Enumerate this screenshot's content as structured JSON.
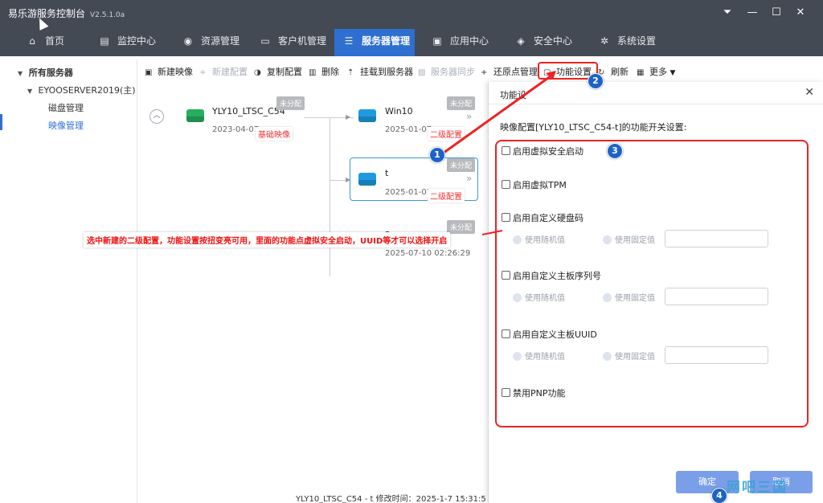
{
  "app": {
    "title": "易乐游服务控制台",
    "version": "V2.5.1.0a"
  },
  "window_controls": {
    "menu_icon": "menu-down-icon",
    "minimize": "—",
    "maximize": "☐",
    "close": "✕"
  },
  "nav": [
    {
      "label": "首页",
      "icon": "home-icon"
    },
    {
      "label": "监控中心",
      "icon": "monitor-chart-icon"
    },
    {
      "label": "资源管理",
      "icon": "gamepad-icon"
    },
    {
      "label": "客户机管理",
      "icon": "desktop-icon"
    },
    {
      "label": "服务器管理",
      "icon": "server-icon",
      "active": true
    },
    {
      "label": "应用中心",
      "icon": "briefcase-icon"
    },
    {
      "label": "安全中心",
      "icon": "shield-icon"
    },
    {
      "label": "系统设置",
      "icon": "gear-icon"
    }
  ],
  "sidebar": {
    "root": "所有服务器",
    "server": "EYOOSERVER2019(主)",
    "items": [
      {
        "label": "磁盘管理"
      },
      {
        "label": "映像管理",
        "selected": true
      }
    ]
  },
  "toolbar": [
    {
      "label": "新建映像",
      "icon": "new-image-icon",
      "enabled": true
    },
    {
      "label": "新建配置",
      "icon": "plus-icon",
      "enabled": false
    },
    {
      "label": "复制配置",
      "icon": "copy-icon",
      "enabled": true
    },
    {
      "label": "删除",
      "icon": "trash-icon",
      "enabled": true
    },
    {
      "label": "挂载到服务器",
      "icon": "mount-icon",
      "enabled": true
    },
    {
      "label": "服务器同步",
      "icon": "sync-icon",
      "enabled": false
    },
    {
      "label": "还原点管理",
      "icon": "plus-icon",
      "enabled": true
    },
    {
      "label": "功能设置",
      "icon": "settings-icon",
      "enabled": true
    },
    {
      "label": "刷新",
      "icon": "refresh-icon",
      "enabled": true
    },
    {
      "label": "更多",
      "icon": "grid-icon",
      "enabled": true
    }
  ],
  "cards": [
    {
      "name": "YLY10_LTSC_C54",
      "date": "2023-04-07",
      "badge": "未分配",
      "drive_color": "#27ae60"
    },
    {
      "name": "Win10",
      "date": "2025-01-07",
      "badge": "未分配",
      "drive_color": "#1e9be0"
    },
    {
      "name": "t",
      "date": "2025-01-07",
      "badge": "未分配",
      "drive_color": "#1e9be0"
    },
    {
      "name": "2",
      "date": "2025-07-10 02:26:29",
      "badge": "未分配",
      "drive_color": "#1e9be0"
    }
  ],
  "labels": {
    "base_image": "基础映像",
    "second_config_1": "二级配置",
    "second_config_2": "二级配置"
  },
  "annotation": "选中新建的二级配置，功能设置按扭变亮可用，里面的功能点虚拟安全启动，UUID等才可以选择开启",
  "status_bar": "YLY10_LTSC_C54 - t 修改时间：2025-1-7 15:31:5",
  "dialog": {
    "title": "功能设",
    "desc": "映像配置[YLY10_LTSC_C54-t]的功能开关设置:",
    "options": [
      {
        "label": "启用虚拟安全启动"
      },
      {
        "label": "启用虚拟TPM"
      },
      {
        "label": "启用自定义硬盘码",
        "random": "使用随机值",
        "fixed": "使用固定值"
      },
      {
        "label": "启用自定义主板序列号",
        "random": "使用随机值",
        "fixed": "使用固定值"
      },
      {
        "label": "启用自定义主板UUID",
        "random": "使用随机值",
        "fixed": "使用固定值"
      },
      {
        "label": "禁用PNP功能"
      }
    ],
    "ok": "确定",
    "cancel": "取消"
  },
  "steps": [
    "1",
    "2",
    "3",
    "4"
  ],
  "watermark": "网吧三国",
  "colors": {
    "topbar": "#434a54",
    "active_nav": "#2f6fd0",
    "highlight_red": "#e22",
    "step_badge": "#1c63c7",
    "button": "#7a9fe8"
  }
}
